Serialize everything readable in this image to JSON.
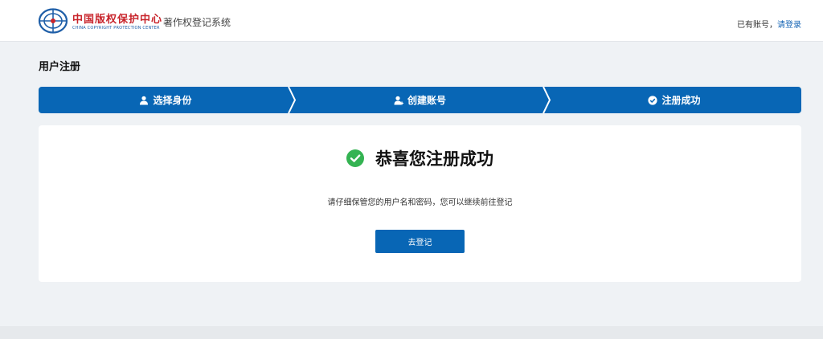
{
  "header": {
    "logo": {
      "cn": "中国版权保护中心",
      "en": "CHINA COPYRIGHT PROTECTION CENTER",
      "icon": "cpcc-emblem-icon"
    },
    "system_name": "著作权登记系统",
    "account_prompt": "已有账号，",
    "login_link": "请登录"
  },
  "page": {
    "title": "用户注册"
  },
  "steps": [
    {
      "label": "选择身份",
      "icon": "user-icon"
    },
    {
      "label": "创建账号",
      "icon": "user-add-icon"
    },
    {
      "label": "注册成功",
      "icon": "check-circle-icon"
    }
  ],
  "result": {
    "title": "恭喜您注册成功",
    "hint": "请仔细保管您的用户名和密码，您可以继续前往登记",
    "button_label": "去登记",
    "icon": "success-check-icon"
  },
  "colors": {
    "primary": "#0866b5",
    "success": "#34b352",
    "brand_red": "#c8252c",
    "link": "#1665b5",
    "page_bg": "#eff2f5"
  }
}
